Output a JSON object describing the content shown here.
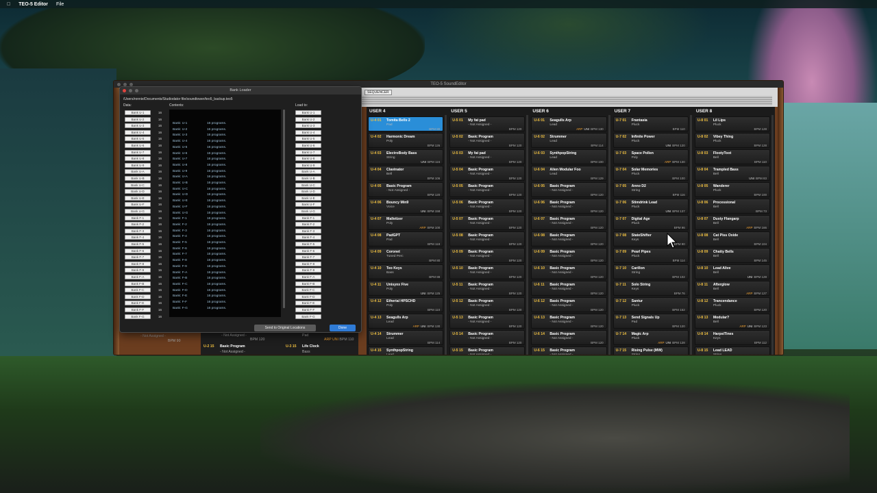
{
  "menubar": {
    "app_name": "TEO-5 Editor",
    "menu_file": "File"
  },
  "app": {
    "title": "TEO-5 SoundEditor",
    "tab": "SEQUENCER"
  },
  "columns": [
    {
      "title": "USER 4",
      "slots": [
        {
          "code": "U-4 01",
          "name": "Tomita Bells 2",
          "cat": "Pad",
          "bpm": "BPM 80",
          "selected": true
        },
        {
          "code": "U-4 02",
          "name": "Harmonic Dream",
          "cat": "Poly",
          "bpm": "BPM 126"
        },
        {
          "code": "U-4 03",
          "name": "ElectroBody  Bass",
          "cat": "String",
          "bpm": "BPM 116",
          "uni": "UNI"
        },
        {
          "code": "U-4 04",
          "name": "Clavinator",
          "cat": "Bell",
          "bpm": "BPM 106"
        },
        {
          "code": "U-4 05",
          "name": "Basic Program",
          "cat": "- Not Assigned -",
          "bpm": "BPM 120"
        },
        {
          "code": "U-4 06",
          "name": "Bouncy Min9",
          "cat": "Voice",
          "bpm": "BPM 158",
          "uni": "UNI"
        },
        {
          "code": "U-4 07",
          "name": "Malletizer",
          "cat": "Poly",
          "bpm": "BPM 100",
          "arp": "ARP"
        },
        {
          "code": "U-4 08",
          "name": "PadGPT",
          "cat": "Pad",
          "bpm": "BPM 118"
        },
        {
          "code": "U-4 09",
          "name": "Coronet",
          "cat": "Tuned Perc",
          "bpm": "BPM 80"
        },
        {
          "code": "U-4 10",
          "name": "Teo Keys",
          "cat": "Bass",
          "bpm": "BPM 88"
        },
        {
          "code": "U-4 11",
          "name": "Unisynx Five",
          "cat": "Poly",
          "bpm": "BPM 125",
          "uni": "UNI"
        },
        {
          "code": "U-4 12",
          "name": "Etherial HPSCHD",
          "cat": "Poly",
          "bpm": "BPM 110"
        },
        {
          "code": "U-4 13",
          "name": "Seagulls Arp",
          "cat": "Lead",
          "bpm": "BPM 130",
          "arp": "ARP",
          "uni": "UNI"
        },
        {
          "code": "U-4 14",
          "name": "Strummer",
          "cat": "Lead",
          "bpm": "BPM 114"
        },
        {
          "code": "U-4 15",
          "name": "SynthpopString",
          "cat": "Lead",
          "bpm": "BPM 100"
        }
      ]
    },
    {
      "title": "USER 5",
      "slots": [
        {
          "code": "U-5 01",
          "name": "My fat pad",
          "cat": "- Not Assigned -",
          "bpm": "BPM 120"
        },
        {
          "code": "U-5 02",
          "name": "Basic Program",
          "cat": "- Not Assigned -",
          "bpm": "BPM 120"
        },
        {
          "code": "U-5 03",
          "name": "My fat pad",
          "cat": "- Not Assigned -",
          "bpm": "BPM 120"
        },
        {
          "code": "U-5 04",
          "name": "Basic Program",
          "cat": "- Not Assigned -",
          "bpm": "BPM 120"
        },
        {
          "code": "U-5 05",
          "name": "Basic Program",
          "cat": "- Not Assigned -",
          "bpm": "BPM 120"
        },
        {
          "code": "U-5 06",
          "name": "Basic Program",
          "cat": "- Not Assigned -",
          "bpm": "BPM 120"
        },
        {
          "code": "U-5 07",
          "name": "Basic Program",
          "cat": "- Not Assigned -",
          "bpm": "BPM 120"
        },
        {
          "code": "U-5 08",
          "name": "Basic Program",
          "cat": "- Not Assigned -",
          "bpm": "BPM 120"
        },
        {
          "code": "U-5 09",
          "name": "Basic Program",
          "cat": "- Not Assigned -",
          "bpm": "BPM 120"
        },
        {
          "code": "U-5 10",
          "name": "Basic Program",
          "cat": "- Not Assigned -",
          "bpm": "BPM 120"
        },
        {
          "code": "U-5 11",
          "name": "Basic Program",
          "cat": "- Not Assigned -",
          "bpm": "BPM 120"
        },
        {
          "code": "U-5 12",
          "name": "Basic Program",
          "cat": "- Not Assigned -",
          "bpm": "BPM 120"
        },
        {
          "code": "U-5 13",
          "name": "Basic Program",
          "cat": "- Not Assigned -",
          "bpm": "BPM 120"
        },
        {
          "code": "U-5 14",
          "name": "Basic Program",
          "cat": "- Not Assigned -",
          "bpm": "BPM 120"
        },
        {
          "code": "U-5 15",
          "name": "Basic Program",
          "cat": "- Not Assigned -",
          "bpm": "BPM 120"
        }
      ]
    },
    {
      "title": "USER 6",
      "slots": [
        {
          "code": "U-6 01",
          "name": "Seagulls Arp",
          "cat": "Lead",
          "bpm": "BPM 130",
          "arp": "ARP",
          "uni": "UNI"
        },
        {
          "code": "U-6 02",
          "name": "Strummer",
          "cat": "Lead",
          "bpm": "BPM 114"
        },
        {
          "code": "U-6 03",
          "name": "SynthpopString",
          "cat": "Lead",
          "bpm": "BPM 100"
        },
        {
          "code": "U-6 04",
          "name": "Alien Modular Foo",
          "cat": "Lead",
          "bpm": "BPM 129"
        },
        {
          "code": "U-6 05",
          "name": "Basic Program",
          "cat": "- Not Assigned -",
          "bpm": "BPM 120"
        },
        {
          "code": "U-6 06",
          "name": "Basic Program",
          "cat": "- Not Assigned -",
          "bpm": "BPM 120"
        },
        {
          "code": "U-6 07",
          "name": "Basic Program",
          "cat": "- Not Assigned -",
          "bpm": "BPM 120"
        },
        {
          "code": "U-6 08",
          "name": "Basic Program",
          "cat": "- Not Assigned -",
          "bpm": "BPM 120"
        },
        {
          "code": "U-6 09",
          "name": "Basic Program",
          "cat": "- Not Assigned -",
          "bpm": "BPM 120"
        },
        {
          "code": "U-6 10",
          "name": "Basic Program",
          "cat": "- Not Assigned -",
          "bpm": "BPM 120"
        },
        {
          "code": "U-6 11",
          "name": "Basic Program",
          "cat": "- Not Assigned -",
          "bpm": "BPM 120"
        },
        {
          "code": "U-6 12",
          "name": "Basic Program",
          "cat": "- Not Assigned -",
          "bpm": "BPM 120"
        },
        {
          "code": "U-6 13",
          "name": "Basic Program",
          "cat": "- Not Assigned -",
          "bpm": "BPM 120"
        },
        {
          "code": "U-6 14",
          "name": "Basic Program",
          "cat": "- Not Assigned -",
          "bpm": "BPM 120"
        },
        {
          "code": "U-6 15",
          "name": "Basic Program",
          "cat": "- Not Assigned -",
          "bpm": "BPM 120"
        }
      ]
    },
    {
      "title": "USER 7",
      "slots": [
        {
          "code": "U-7 01",
          "name": "Frantasia",
          "cat": "Pluck",
          "bpm": "BPM 110"
        },
        {
          "code": "U-7 02",
          "name": "Infinite  Power",
          "cat": "Pluck",
          "bpm": "BPM 120",
          "uni": "UNI"
        },
        {
          "code": "U-7 03",
          "name": "Space Pollen",
          "cat": "Poly",
          "bpm": "BPM 130",
          "arp": "ARP"
        },
        {
          "code": "U-7 04",
          "name": "Solar Memories",
          "cat": "Pluck",
          "bpm": "BPM 100"
        },
        {
          "code": "U-7 05",
          "name": "Anno D2",
          "cat": "String",
          "bpm": "BPM 116"
        },
        {
          "code": "U-7 06",
          "name": "Stimdrink Lead",
          "cat": "Pluck",
          "bpm": "BPM 137",
          "uni": "UNI"
        },
        {
          "code": "U-7 07",
          "name": "Digital Age",
          "cat": "Pluck",
          "bpm": "BPM 96"
        },
        {
          "code": "U-7 08",
          "name": "StateShifter",
          "cat": "Keys",
          "bpm": "BPM 90"
        },
        {
          "code": "U-7 09",
          "name": "Pearl Pipes",
          "cat": "Pluck",
          "bpm": "BPM 114"
        },
        {
          "code": "U-7 10",
          "name": "Carillon",
          "cat": "String",
          "bpm": "BPM 102"
        },
        {
          "code": "U-7 11",
          "name": "Solo String",
          "cat": "Keys",
          "bpm": "BPM 76"
        },
        {
          "code": "U-7 12",
          "name": "Santur",
          "cat": "Pluck",
          "bpm": "BPM 152"
        },
        {
          "code": "U-7 13",
          "name": "Send Signals Up",
          "cat": "Pad",
          "bpm": "BPM 120"
        },
        {
          "code": "U-7 14",
          "name": "Magic Arp",
          "cat": "Pluck",
          "bpm": "BPM 128",
          "arp": "ARP",
          "uni": "UNI"
        },
        {
          "code": "U-7 15",
          "name": "Rising Pulse (MW)",
          "cat": "String",
          "bpm": "BPM 120"
        }
      ]
    },
    {
      "title": "USER 8",
      "slots": [
        {
          "code": "U-8 01",
          "name": "Lil  Lips",
          "cat": "Pluck",
          "bpm": "BPM 128"
        },
        {
          "code": "U-8 02",
          "name": "Vibey Thing",
          "cat": "Pluck",
          "bpm": "BPM 128"
        },
        {
          "code": "U-8 03",
          "name": "FlootyToot",
          "cat": "Bell",
          "bpm": "BPM 110"
        },
        {
          "code": "U-8 04",
          "name": "Trampled Bass",
          "cat": "Bell",
          "bpm": "BPM 83",
          "uni": "UNI"
        },
        {
          "code": "U-8 05",
          "name": "Wanderer",
          "cat": "Pluck",
          "bpm": "BPM 100"
        },
        {
          "code": "U-8 06",
          "name": "Processional",
          "cat": "Bell",
          "bpm": "BPM 73"
        },
        {
          "code": "U-8 07",
          "name": "Dusty Flangarp",
          "cat": "Bell",
          "bpm": "BPM 166",
          "arp": "ARP"
        },
        {
          "code": "U-8 08",
          "name": "Cat Piss Oxide",
          "cat": "Bell",
          "bpm": "BPM 104"
        },
        {
          "code": "U-8 09",
          "name": "Chatty Bells",
          "cat": "Bell",
          "bpm": "BPM 145"
        },
        {
          "code": "U-8 10",
          "name": "Lead Alive",
          "cat": "Bell",
          "bpm": "BPM 128",
          "uni": "UNI"
        },
        {
          "code": "U-8 11",
          "name": "Afterglow",
          "cat": "Bell",
          "bpm": "BPM 127",
          "arp": "ARP"
        },
        {
          "code": "U-8 12",
          "name": "Trancendance",
          "cat": "Pluck",
          "bpm": "BPM 120"
        },
        {
          "code": "U-8 13",
          "name": "Modular?",
          "cat": "Bell",
          "bpm": "BPM 123",
          "arp": "ARP",
          "uni": "UNI"
        },
        {
          "code": "U-8 14",
          "name": "HarpsiTines",
          "cat": "Keys",
          "bpm": "BPM 112"
        },
        {
          "code": "U-8 15",
          "name": "Lead LEAD",
          "cat": "String",
          "bpm": "BPM 120"
        }
      ]
    }
  ],
  "behind": {
    "a_cat": "- Not Assigned -",
    "a_bpm": "BPM 90",
    "b_cat": "- Not Assigned -",
    "b_bpm": "BPM 120",
    "b_code": "U-2 15",
    "b_name": "Basic Program",
    "b2_cat": "- Not Assigned -",
    "c_cat": "Pad",
    "c_bpm": "BPM 110",
    "c_tags": "ARP UNI",
    "c_code": "U-3 15",
    "c_name": "Life Clock",
    "c2_cat": "Bass"
  },
  "loader": {
    "title": "Bank Loader",
    "path": "/Users/ronnie/Documents/Studiodator file/soundtower/teo5_backup.teo5",
    "data_label": "Data:",
    "contents_label": "Contents:",
    "load_label": "Load to:",
    "banks": [
      "Bank U-1",
      "Bank U-2",
      "Bank U-3",
      "Bank U-4",
      "Bank U-5",
      "Bank U-6",
      "Bank U-7",
      "Bank U-8",
      "Bank U-9",
      "Bank U-A",
      "Bank U-B",
      "Bank U-C",
      "Bank U-D",
      "Bank U-E",
      "Bank U-F",
      "Bank U-G",
      "Bank F-1",
      "Bank F-2",
      "Bank F-3",
      "Bank F-4",
      "Bank F-5",
      "Bank F-6",
      "Bank F-7",
      "Bank F-8",
      "Bank F-9",
      "Bank F-A",
      "Bank F-B",
      "Bank F-C",
      "Bank F-D",
      "Bank F-E",
      "Bank F-F",
      "Bank F-G"
    ],
    "count": "16",
    "contents": [
      "Bank: U-1",
      "Bank: U-2",
      "Bank: U-3",
      "Bank: U-4",
      "Bank: U-5",
      "Bank: U-6",
      "Bank: U-7",
      "Bank: U-8",
      "Bank: U-9",
      "Bank: U-A",
      "Bank: U-B",
      "Bank: U-C",
      "Bank: U-D",
      "Bank: U-E",
      "Bank: U-F",
      "Bank: U-G",
      "Bank: F-1",
      "Bank: F-2",
      "Bank: F-3",
      "Bank: F-4",
      "Bank: F-5",
      "Bank: F-6",
      "Bank: F-7",
      "Bank: F-8",
      "Bank: F-9",
      "Bank: F-A",
      "Bank: F-B",
      "Bank: F-C",
      "Bank: F-D",
      "Bank: F-E",
      "Bank: F-F",
      "Bank: F-G"
    ],
    "programs": "16  programs.",
    "send_label": "Send to Original Locations",
    "done_label": "Done"
  },
  "colors": {
    "accent": "#2f7bd6",
    "code": "#f0c040",
    "arp": "#f0a030"
  }
}
